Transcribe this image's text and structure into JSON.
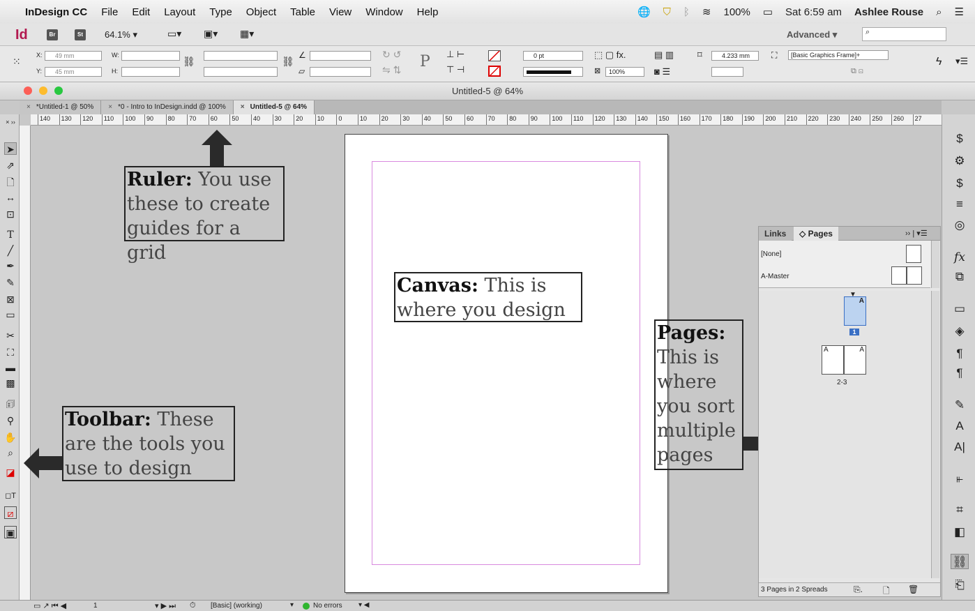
{
  "menubar": {
    "app_name": "InDesign CC",
    "items": [
      "File",
      "Edit",
      "Layout",
      "Type",
      "Object",
      "Table",
      "View",
      "Window",
      "Help"
    ],
    "battery": "100%",
    "clock": "Sat 6:59 am",
    "user": "Ashlee Rouse"
  },
  "appbar": {
    "logo": "Id",
    "bridge": "Br",
    "stock": "St",
    "zoom": "64.1%",
    "workspace": "Advanced"
  },
  "control": {
    "x_label": "X:",
    "x_value": "49 mm",
    "y_label": "Y:",
    "y_value": "45 mm",
    "w_label": "W:",
    "h_label": "H:",
    "stroke_weight": "0 pt",
    "opacity": "100%",
    "gap_value": "4.233 mm",
    "object_style": "[Basic Graphics Frame]+"
  },
  "window": {
    "title": "Untitled-5 @ 64%",
    "tabs": [
      {
        "label": "*Untitled-1 @ 50%"
      },
      {
        "label": "*0 - Intro to InDesign.indd @ 100%"
      },
      {
        "label": "Untitled-5 @ 64%"
      }
    ]
  },
  "ruler": {
    "ticks": [
      "140",
      "130",
      "120",
      "110",
      "100",
      "90",
      "80",
      "70",
      "60",
      "50",
      "40",
      "30",
      "20",
      "10",
      "0",
      "10",
      "20",
      "30",
      "40",
      "50",
      "60",
      "70",
      "80",
      "90",
      "100",
      "110",
      "120",
      "130",
      "140",
      "150",
      "160",
      "170",
      "180",
      "190",
      "200",
      "210",
      "220",
      "230",
      "240",
      "250",
      "260",
      "27"
    ]
  },
  "annotations": {
    "ruler_title": "Ruler:",
    "ruler_text": " You use these to create guides for a grid",
    "canvas_title": "Canvas:",
    "canvas_text": " This is where you design",
    "pages_title": "Pages:",
    "pages_text": " This is where you sort multiple pages",
    "toolbar_title": "Toolbar:",
    "toolbar_text": " These are the tools you use to design"
  },
  "pages_panel": {
    "tab_links": "Links",
    "tab_pages": "Pages",
    "master_none": "[None]",
    "master_a": "A-Master",
    "page1_label": "1",
    "page23_label": "2-3",
    "master_letter": "A",
    "footer": "3 Pages in 2 Spreads"
  },
  "statusbar": {
    "page_num": "1",
    "profile": "[Basic] (working)",
    "preflight": "No errors"
  },
  "colors": {
    "accent_id": "#b2184f",
    "margin_guide": "#d98adf",
    "status_ok": "#2fb52f"
  }
}
